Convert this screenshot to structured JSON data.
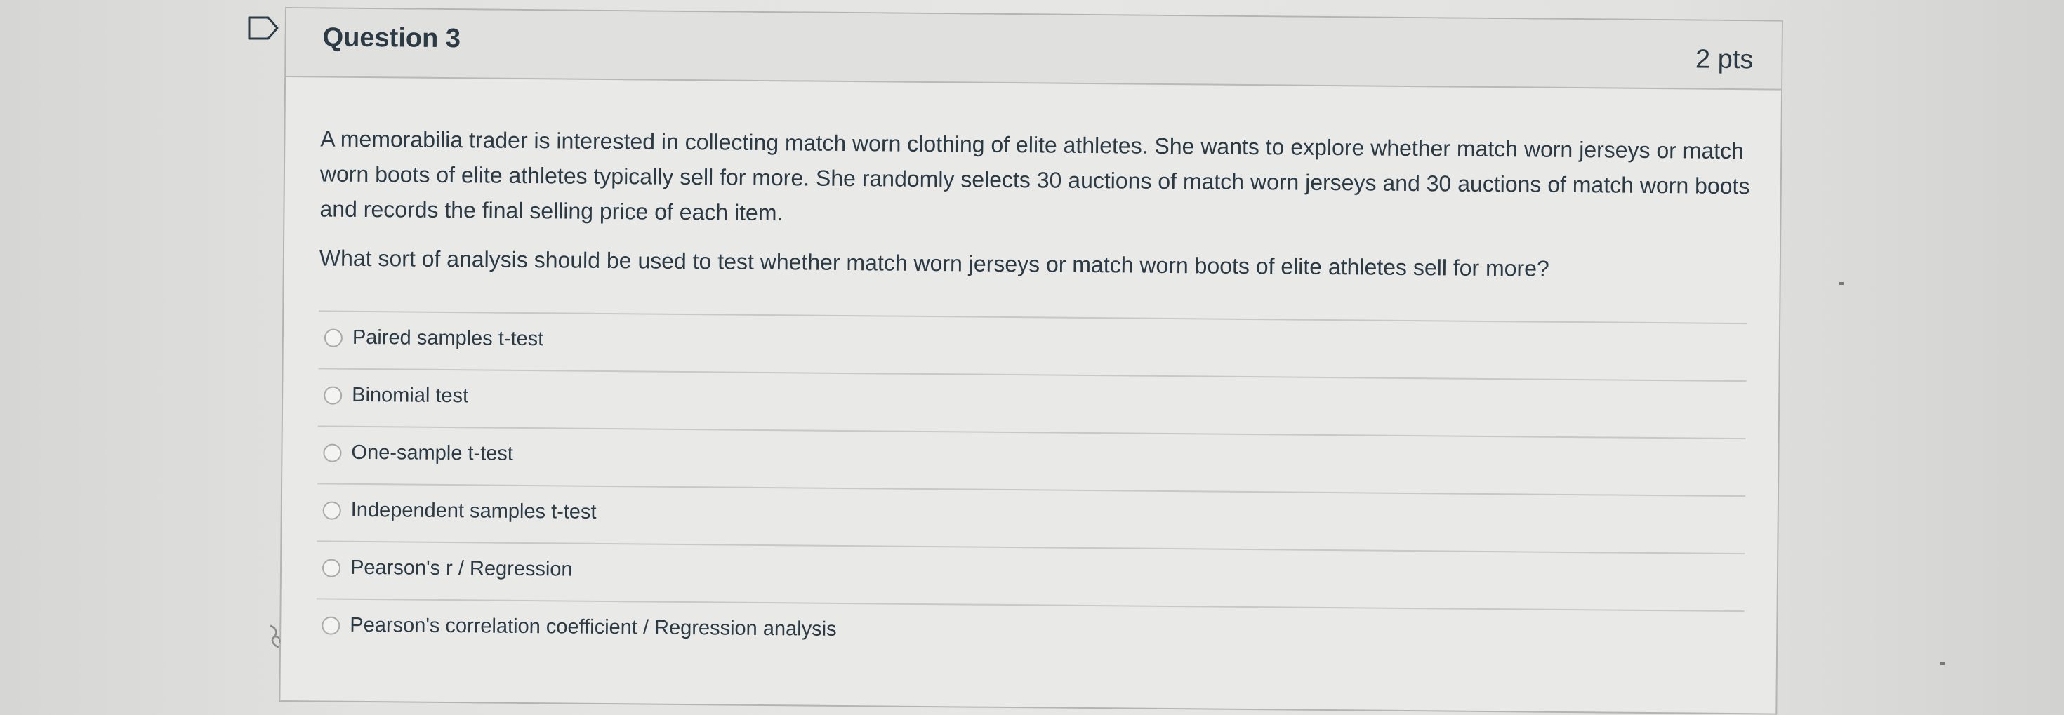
{
  "question": {
    "title": "Question 3",
    "points": "2 pts",
    "stem": "A memorabilia trader is interested in collecting match worn clothing of elite athletes. She wants to explore whether match worn jerseys or match worn boots of elite athletes typically sell for more. She randomly selects 30 auctions of match worn jerseys and 30 auctions of match worn boots and records the final selling price of each item.",
    "prompt": "What sort of analysis should be used to test whether match worn jerseys or match worn boots of elite athletes sell for more?"
  },
  "answers": [
    {
      "label": "Paired samples t-test"
    },
    {
      "label": "Binomial test"
    },
    {
      "label": "One-sample t-test"
    },
    {
      "label": "Independent samples t-test"
    },
    {
      "label": "Pearson's r / Regression"
    },
    {
      "label": "Pearson's correlation coefficient / Regression analysis"
    }
  ],
  "colors": {
    "text": "#2b3a44",
    "card_bg": "#e9e9e7",
    "header_bg": "#e0e0de",
    "border": "#b4b4b2"
  },
  "icons": {
    "flag": "bookmark-flag-icon",
    "radio": "radio-button-icon",
    "cursor": "cursor-icon"
  }
}
